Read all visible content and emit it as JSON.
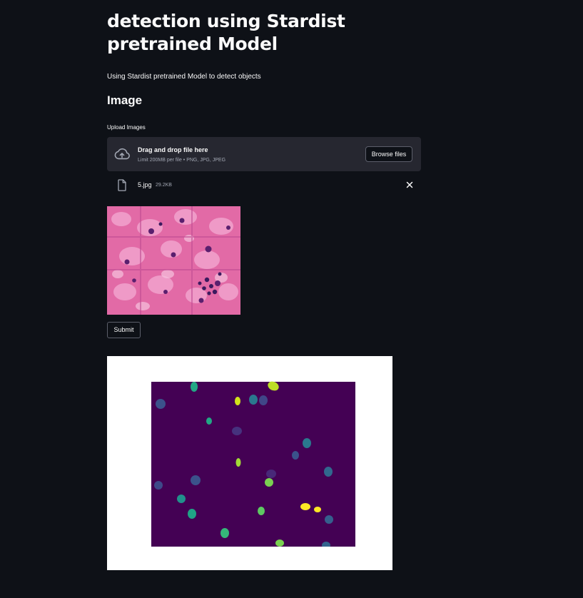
{
  "page": {
    "title": "detection using Stardist pretrained Model",
    "subtitle": "Using Stardist pretrained Model to detect objects"
  },
  "image_section": {
    "heading": "Image"
  },
  "uploader": {
    "label": "Upload Images",
    "drop_title": "Drag and drop file here",
    "drop_limit": "Limit 200MB per file • PNG, JPG, JPEG",
    "browse_label": "Browse files",
    "icon": "cloud-upload-icon"
  },
  "uploaded_file": {
    "name": "5.jpg",
    "size": "29.2KB",
    "icon": "file-icon",
    "remove_icon": "close-icon"
  },
  "submit": {
    "label": "Submit"
  },
  "colors": {
    "background": "#0e1117",
    "dropzone": "#262730",
    "label_map_background": "#440154",
    "tissue_pink": "#e26aa6"
  }
}
